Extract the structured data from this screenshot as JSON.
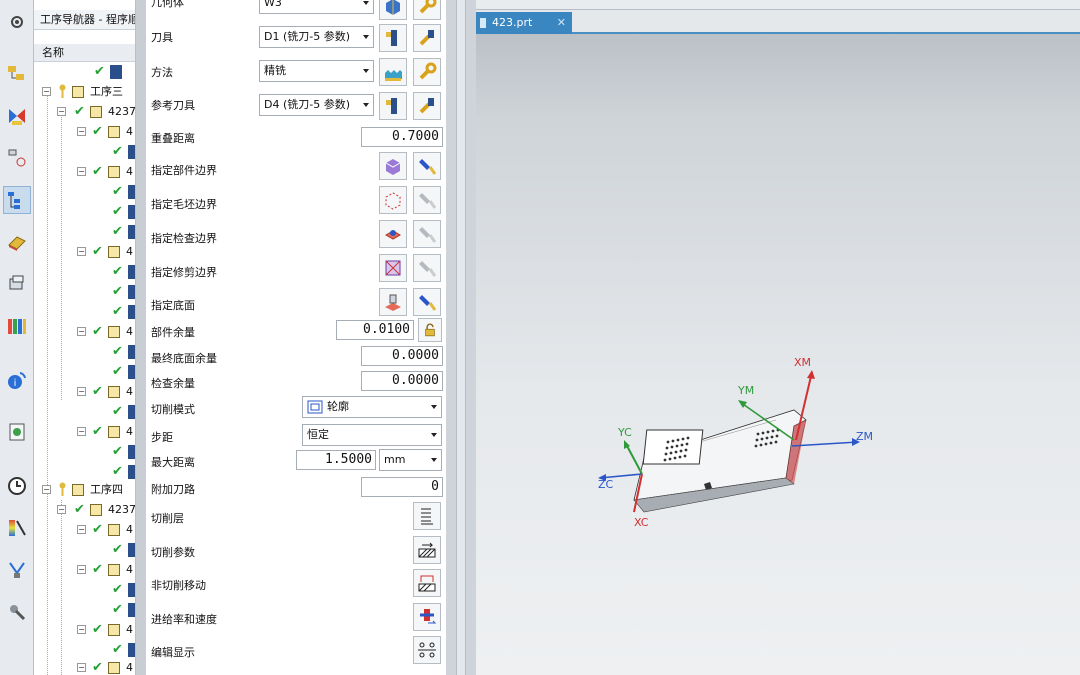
{
  "navigator": {
    "title": "工序导航器 - 程序顺序",
    "column_header": "名称",
    "nodes": [
      {
        "label": "工序三"
      },
      {
        "label": "4237"
      },
      {
        "label": "工序四"
      },
      {
        "label": "4237"
      }
    ],
    "truncated_item_label": "4"
  },
  "dialog": {
    "geometry": {
      "label": "几何体",
      "value": "W3"
    },
    "tool": {
      "label": "刀具",
      "value": "D1 (铣刀-5 参数)"
    },
    "method": {
      "label": "方法",
      "value": "精铣"
    },
    "ref_tool": {
      "label": "参考刀具",
      "value": "D4 (铣刀-5 参数)"
    },
    "overlap": {
      "label": "重叠距离",
      "value": "0.7000"
    },
    "part_boundary": {
      "label": "指定部件边界"
    },
    "blank_boundary": {
      "label": "指定毛坯边界"
    },
    "check_boundary": {
      "label": "指定检查边界"
    },
    "trim_boundary": {
      "label": "指定修剪边界"
    },
    "floor": {
      "label": "指定底面"
    },
    "part_stock": {
      "label": "部件余量",
      "value": "0.0100"
    },
    "floor_stock": {
      "label": "最终底面余量",
      "value": "0.0000"
    },
    "check_stock": {
      "label": "检查余量",
      "value": "0.0000"
    },
    "cut_pattern": {
      "label": "切削模式",
      "value": "轮廓"
    },
    "stepover": {
      "label": "步距",
      "value": "恒定"
    },
    "max_distance": {
      "label": "最大距离",
      "value": "1.5000",
      "unit": "mm"
    },
    "additional_passes": {
      "label": "附加刀路",
      "value": "0"
    },
    "cut_levels": {
      "label": "切削层"
    },
    "cut_params": {
      "label": "切削参数"
    },
    "non_cut_moves": {
      "label": "非切削移动"
    },
    "feeds_speeds": {
      "label": "进给率和速度"
    },
    "edit_display": {
      "label": "编辑显示"
    }
  },
  "viewport": {
    "tab_label": "423.prt",
    "axes": {
      "xm": "XM",
      "ym": "YM",
      "zm": "ZM",
      "xc": "XC",
      "yc": "YC",
      "zc": "ZC"
    }
  },
  "colors": {
    "tab_blue": "#3a86c0",
    "check_green": "#22a033",
    "axis_red": "#d23030",
    "axis_green": "#2e9a3a",
    "axis_blue": "#2a56c8"
  }
}
